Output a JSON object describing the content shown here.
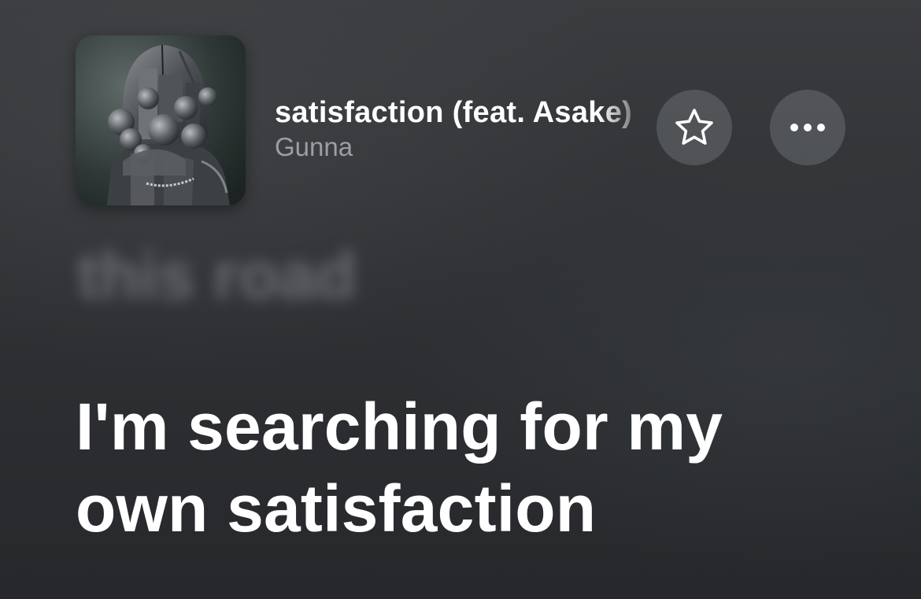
{
  "now_playing": {
    "title": "satisfaction (feat. Asake)",
    "artist": "Gunna",
    "artwork_icon": "album-artwork",
    "favorite_icon": "star-icon",
    "more_icon": "more-ellipsis-icon"
  },
  "lyrics": {
    "previous_line": "this road",
    "current_line_1": "I'm searching for my",
    "current_line_2": "own satisfaction"
  },
  "colors": {
    "background": "#2f3134",
    "text_primary": "#ffffff",
    "text_secondary": "#9b9ea2",
    "button_bg": "#5a5d61"
  }
}
